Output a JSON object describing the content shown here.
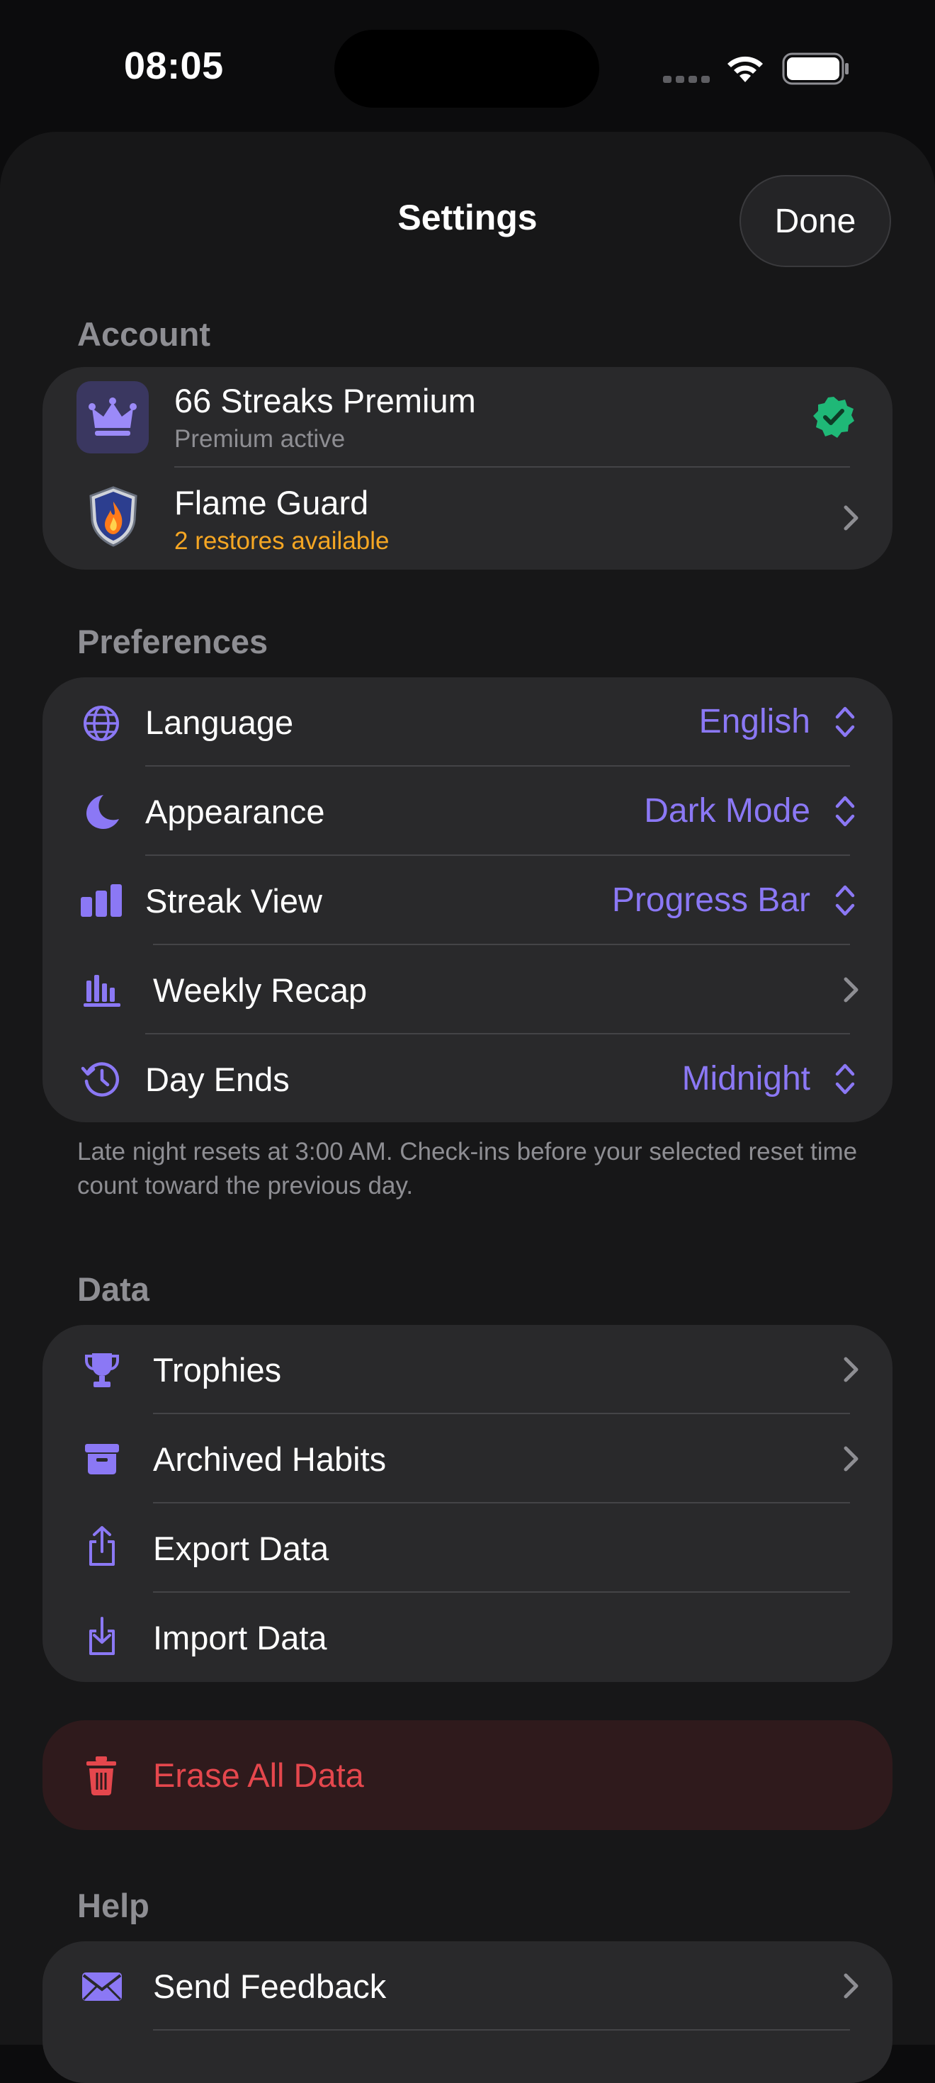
{
  "status_bar": {
    "time": "08:05"
  },
  "header": {
    "title": "Settings",
    "done_label": "Done"
  },
  "account": {
    "header": "Account",
    "premium": {
      "title": "66 Streaks Premium",
      "subtitle": "Premium active",
      "icon": "crown-icon",
      "status_icon": "verified-badge-icon"
    },
    "flame_guard": {
      "title": "Flame Guard",
      "subtitle": "2 restores available",
      "icon": "shield-flame-icon"
    }
  },
  "preferences": {
    "header": "Preferences",
    "items": [
      {
        "label": "Language",
        "value": "English",
        "icon": "globe-icon"
      },
      {
        "label": "Appearance",
        "value": "Dark Mode",
        "icon": "moon-icon"
      },
      {
        "label": "Streak View",
        "value": "Progress Bar",
        "icon": "bar-chart-icon"
      },
      {
        "label": "Weekly Recap",
        "value": "",
        "icon": "recap-chart-icon"
      },
      {
        "label": "Day Ends",
        "value": "Midnight",
        "icon": "clock-history-icon"
      }
    ],
    "footnote": "Late night resets at 3:00 AM. Check-ins before your selected reset time count toward the previous day."
  },
  "data_section": {
    "header": "Data",
    "items": [
      {
        "label": "Trophies",
        "icon": "trophy-icon"
      },
      {
        "label": "Archived Habits",
        "icon": "archive-box-icon"
      },
      {
        "label": "Export Data",
        "icon": "share-upload-icon"
      },
      {
        "label": "Import Data",
        "icon": "download-tray-icon"
      }
    ]
  },
  "erase": {
    "label": "Erase All Data",
    "icon": "trash-icon"
  },
  "help": {
    "header": "Help",
    "items": [
      {
        "label": "Send Feedback",
        "icon": "envelope-icon"
      }
    ]
  },
  "colors": {
    "accent": "#8b78f5",
    "orange": "#f5a623",
    "green_badge": "#1fb877",
    "destructive": "#e5474d",
    "card_bg": "#29292b",
    "sheet_bg": "#171718"
  }
}
